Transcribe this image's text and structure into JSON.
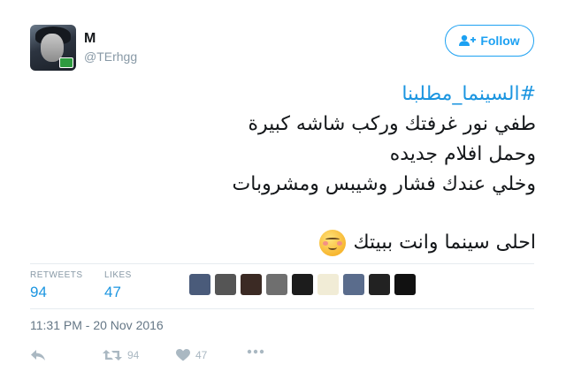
{
  "user": {
    "name": "M",
    "handle": "@TErhgg"
  },
  "follow_button": {
    "label": "Follow"
  },
  "tweet": {
    "hashtag": "#السينما_مطلبنا",
    "lines": [
      "طفي نور غرفتك وركب شاشه كبيرة",
      "وحمل افلام جديده",
      "وخلي عندك فشار وشيبس ومشروبات",
      "احلى سينما وانت ببيتك"
    ],
    "emoji": "smiling-face-with-blush-icon"
  },
  "stats": {
    "retweets_label": "RETWEETS",
    "retweets_value": "94",
    "likes_label": "LIKES",
    "likes_value": "47"
  },
  "likers": [
    {
      "name": "liker-avatar-1",
      "color": "#4a5b7a"
    },
    {
      "name": "liker-avatar-2",
      "color": "#555555"
    },
    {
      "name": "liker-avatar-3",
      "color": "#3b2a24"
    },
    {
      "name": "liker-avatar-4",
      "color": "#6f6f6f"
    },
    {
      "name": "liker-avatar-5",
      "color": "#1c1c1c"
    },
    {
      "name": "liker-avatar-6",
      "color": "#f1ecd6"
    },
    {
      "name": "liker-avatar-7",
      "color": "#5a6c8c"
    },
    {
      "name": "liker-avatar-8",
      "color": "#222222"
    },
    {
      "name": "liker-avatar-9",
      "color": "#111111"
    }
  ],
  "timestamp": "11:31 PM - 20 Nov 2016",
  "actions": {
    "reply_icon": "reply-icon",
    "retweet_count": "94",
    "like_count": "47",
    "more_icon": "more-icon"
  },
  "colors": {
    "accent": "#1da1f2",
    "link": "#1b95e0",
    "muted": "#8899a6",
    "action_gray": "#aab8c2"
  }
}
